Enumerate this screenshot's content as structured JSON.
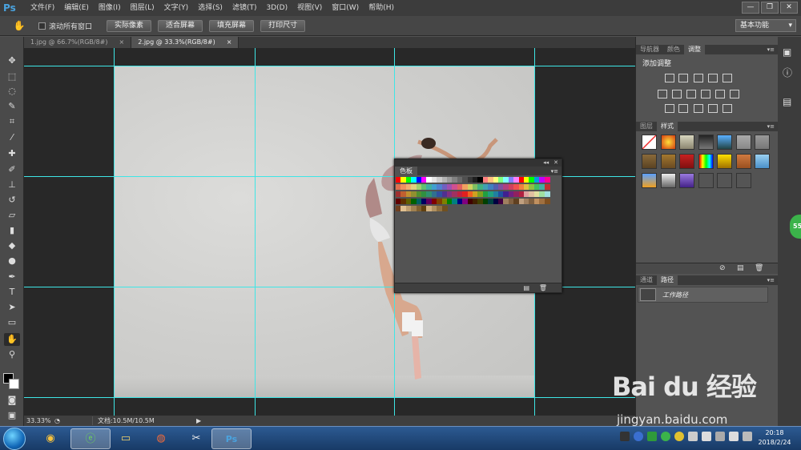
{
  "app": {
    "logo": "Ps"
  },
  "menu": [
    "文件(F)",
    "编辑(E)",
    "图像(I)",
    "图层(L)",
    "文字(Y)",
    "选择(S)",
    "滤镜(T)",
    "3D(D)",
    "视图(V)",
    "窗口(W)",
    "帮助(H)"
  ],
  "window_controls": {
    "minimize": "—",
    "restore": "❐",
    "close": "✕"
  },
  "options": {
    "tool_icon": "hand-icon",
    "scroll_all_label": "滚动所有窗口",
    "scroll_all_checked": false,
    "buttons": [
      "实际像素",
      "适合屏幕",
      "填充屏幕",
      "打印尺寸"
    ],
    "workspace": "基本功能"
  },
  "tabs": [
    {
      "label": "1.jpg @ 66.7%(RGB/8#)",
      "close": "×",
      "active": false
    },
    {
      "label": "2.jpg @ 33.3%(RGB/8#)",
      "close": "×",
      "active": true
    }
  ],
  "status": {
    "zoom": "33.33%",
    "doc": "文档:10.5M/10.5M"
  },
  "swatches_panel": {
    "title": "色板",
    "collapse": "◂◂",
    "close": "✕"
  },
  "swatch_colors": [
    [
      "#ff0000",
      "#ffff00",
      "#00ff00",
      "#00ffff",
      "#0000ff",
      "#ff00ff",
      "#ffffff",
      "#e6e6e6",
      "#cdcdcd",
      "#b4b4b4",
      "#9b9b9b",
      "#828282",
      "#696969",
      "#505050",
      "#373737",
      "#1e1e1e",
      "#000000",
      "#ff8080",
      "#ffc080",
      "#ffff80",
      "#80ff80",
      "#80ffff",
      "#8080ff",
      "#ff80ff",
      "#ff0000",
      "#ffff00",
      "#00ff00",
      "#00a0e0",
      "#c000ff",
      "#ff0090"
    ],
    [
      "#e07050",
      "#f09060",
      "#f0b070",
      "#e0d080",
      "#a0d070",
      "#60c070",
      "#40b0a0",
      "#40a0d0",
      "#5080d0",
      "#7060c0",
      "#a050b0",
      "#d05090",
      "#e06060",
      "#f0a060",
      "#d0d060",
      "#80c060",
      "#40b080",
      "#40a0b0",
      "#4080c0",
      "#5060b0",
      "#8050a0",
      "#b04080",
      "#d04060",
      "#f05050",
      "#f08040",
      "#e0c040",
      "#90c040",
      "#40c060",
      "#40b0a0",
      "#c03030"
    ],
    [
      "#a03030",
      "#c06030",
      "#c09030",
      "#909030",
      "#509030",
      "#309040",
      "#309070",
      "#307090",
      "#3050a0",
      "#503090",
      "#803080",
      "#a03060",
      "#c02040",
      "#e02020",
      "#f06020",
      "#d0a020",
      "#80a020",
      "#20a040",
      "#20a080",
      "#2080a0",
      "#2050a0",
      "#402090",
      "#702080",
      "#902060",
      "#b02040",
      "#e0a0a0",
      "#e0c0a0",
      "#e0e0a0",
      "#a0e0a0",
      "#a0e0e0"
    ],
    [
      "#600000",
      "#603000",
      "#606000",
      "#006000",
      "#006060",
      "#000060",
      "#600060",
      "#800000",
      "#804000",
      "#808000",
      "#008000",
      "#008080",
      "#000080",
      "#800080",
      "#400000",
      "#402000",
      "#404000",
      "#004000",
      "#004040",
      "#000040",
      "#400040",
      "#a08060",
      "#806040",
      "#604020",
      "#c0a080",
      "#a08060",
      "#806040",
      "#c09060",
      "#a07040",
      "#805020"
    ],
    [
      "#704020",
      "#e0c090",
      "#c0a070",
      "#a08050",
      "#806030",
      "#604010",
      "#d0b080",
      "#b09060",
      "#907040",
      "#705020"
    ]
  ],
  "nav_tabs": [
    "导航器",
    "颜色",
    "调整"
  ],
  "adjust": {
    "title": "添加调整"
  },
  "styles_tabs": [
    "图层",
    "样式"
  ],
  "paths_tabs": [
    "通道",
    "路径"
  ],
  "path_item": "工作路径",
  "taskbar": {
    "time": "20:18",
    "date": "2018/2/24"
  },
  "watermark": {
    "brand": "Bai du 经验",
    "url": "jingyan.baidu.com"
  },
  "float_badge": "55"
}
